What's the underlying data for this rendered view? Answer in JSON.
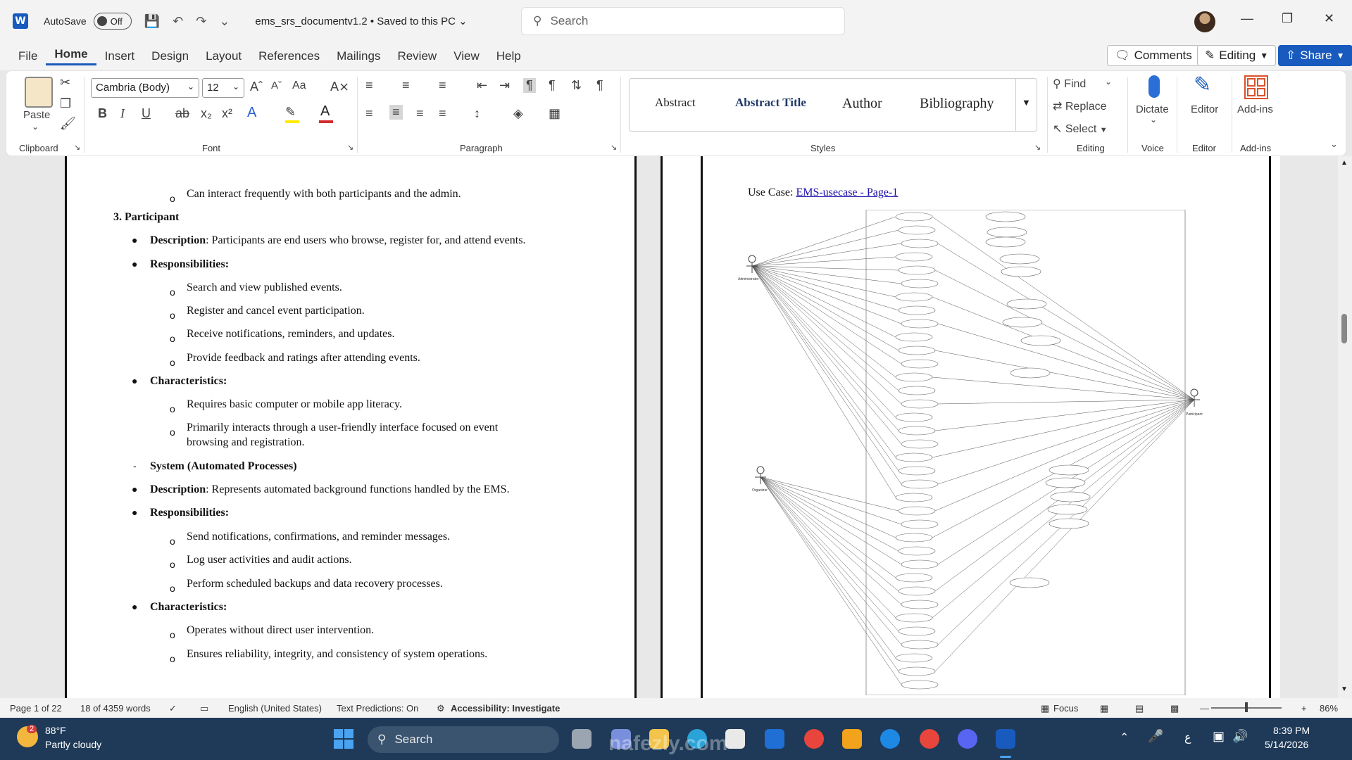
{
  "titlebar": {
    "app_logo": "W",
    "autosave_label": "AutoSave",
    "autosave_state": "Off",
    "document_name": "ems_srs_documentv1.2 • Saved to this PC ⌄",
    "search_placeholder": "Search"
  },
  "menubar": {
    "tabs": [
      "File",
      "Home",
      "Insert",
      "Design",
      "Layout",
      "References",
      "Mailings",
      "Review",
      "View",
      "Help"
    ],
    "active_tab": "Home",
    "comments_label": "Comments",
    "editing_label": "Editing",
    "share_label": "Share"
  },
  "ribbon": {
    "clipboard": {
      "paste_label": "Paste",
      "group_label": "Clipboard"
    },
    "font": {
      "font_name": "Cambria (Body)",
      "font_size": "12",
      "group_label": "Font",
      "case_label": "Aa"
    },
    "paragraph": {
      "group_label": "Paragraph"
    },
    "styles": {
      "items": [
        "Abstract",
        "Abstract Title",
        "Author",
        "Bibliography"
      ],
      "group_label": "Styles"
    },
    "editing": {
      "find_label": "Find",
      "replace_label": "Replace",
      "select_label": "Select",
      "group_label": "Editing"
    },
    "voice": {
      "dictate_label": "Dictate",
      "group_label": "Voice"
    },
    "editor": {
      "editor_label": "Editor",
      "group_label": "Editor"
    },
    "addins": {
      "addins_label": "Add-ins",
      "group_label": "Add-ins"
    }
  },
  "document": {
    "page1": {
      "line1": "Can interact frequently with both participants and the admin.",
      "heading_participant": "3. Participant",
      "desc_label": "Description",
      "desc_text": ": Participants are end users who browse, register for, and attend events.",
      "resp_label": "Responsibilities:",
      "resp_items": [
        "Search and view published events.",
        "Register and cancel event participation.",
        "Receive notifications, reminders, and updates.",
        "Provide feedback and ratings after attending events."
      ],
      "char_label": "Characteristics:",
      "char_items": [
        "Requires basic computer or mobile app literacy.",
        "Primarily interacts through a user-friendly interface focused on event",
        "browsing and registration."
      ],
      "system_heading": "System (Automated Processes)",
      "sys_desc_label": "Description",
      "sys_desc_text": ": Represents automated background functions handled by the EMS.",
      "sys_resp_label": "Responsibilities:",
      "sys_resp_items": [
        "Send notifications, confirmations, and reminder messages.",
        "Log user activities and audit actions.",
        "Perform scheduled backups and data recovery processes."
      ],
      "sys_char_label": "Characteristics:",
      "sys_char_items": [
        "Operates without direct user intervention.",
        "Ensures reliability, integrity, and consistency of system operations."
      ]
    },
    "page2": {
      "usecase_label": "Use Case: ",
      "usecase_link": "EMS-usecase - Page-1",
      "actor_labels": [
        "Administrator",
        "Organizer",
        "Participant"
      ]
    }
  },
  "statusbar": {
    "page": "Page 1 of 22",
    "words": "18 of 4359 words",
    "language": "English (United States)",
    "predictions": "Text Predictions: On",
    "accessibility": "Accessibility: Investigate",
    "focus": "Focus",
    "zoom": "86%"
  },
  "taskbar": {
    "weather_temp": "88°F",
    "weather_desc": "Partly cloudy",
    "weather_badge": "2",
    "search_label": "Search",
    "time": "8:39 PM",
    "date": "5/14/2026",
    "watermark": "nafezly.com"
  }
}
